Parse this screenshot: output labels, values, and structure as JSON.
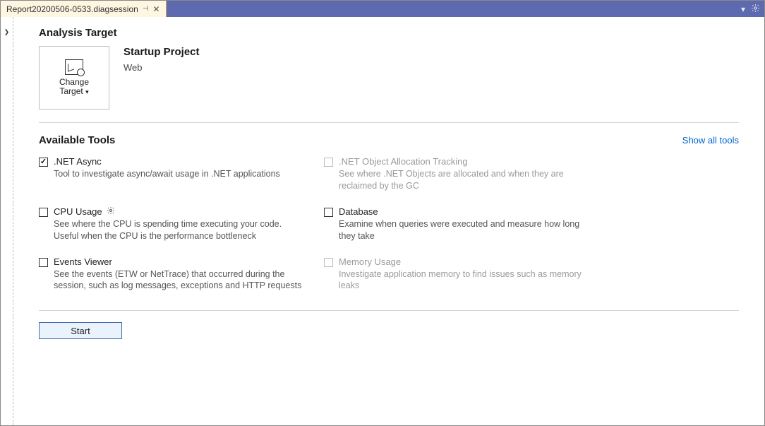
{
  "tab": {
    "title": "Report20200506-0533.diagsession",
    "pinned_glyph": "⊣",
    "close_glyph": "✕"
  },
  "titlebar_menu": {
    "dropdown_glyph": "▾"
  },
  "gutter": {
    "expand_glyph": "❯"
  },
  "analysisTarget": {
    "heading": "Analysis Target",
    "changeTarget": {
      "line1": "Change",
      "line2": "Target",
      "drop_glyph": "▾"
    },
    "projectTitle": "Startup Project",
    "projectSub": "Web"
  },
  "tools": {
    "heading": "Available Tools",
    "showAll": "Show all tools",
    "items": [
      {
        "title": ".NET Async",
        "desc": "Tool to investigate async/await usage in .NET applications",
        "checked": true,
        "disabled": false,
        "gear": false
      },
      {
        "title": ".NET Object Allocation Tracking",
        "desc": "See where .NET Objects are allocated and when they are reclaimed by the GC",
        "checked": false,
        "disabled": true,
        "gear": false
      },
      {
        "title": "CPU Usage",
        "desc": "See where the CPU is spending time executing your code. Useful when the CPU is the performance bottleneck",
        "checked": false,
        "disabled": false,
        "gear": true
      },
      {
        "title": "Database",
        "desc": "Examine when queries were executed and measure how long they take",
        "checked": false,
        "disabled": false,
        "gear": false
      },
      {
        "title": "Events Viewer",
        "desc": "See the events (ETW or NetTrace) that occurred during the session, such as log messages, exceptions and HTTP requests",
        "checked": false,
        "disabled": false,
        "gear": false
      },
      {
        "title": "Memory Usage",
        "desc": "Investigate application memory to find issues such as memory leaks",
        "checked": false,
        "disabled": true,
        "gear": false
      }
    ]
  },
  "start": {
    "label": "Start"
  }
}
